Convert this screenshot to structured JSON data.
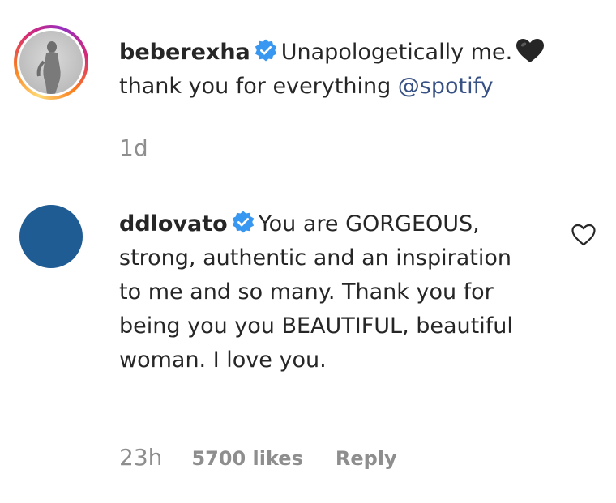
{
  "caption": {
    "username": "beberexha",
    "text_line1": "Unapologetically me.",
    "text_line2_prefix": "thank you for everything ",
    "mention": "@spotify",
    "emoji": "black-heart-emoji",
    "time": "1d"
  },
  "reply": {
    "username": "ddlovato",
    "text": "You are GORGEOUS, strong, authentic and an inspiration to me and so many. Thank you for being you you BEAUTIFUL, beautiful woman. I love you.",
    "time": "23h",
    "likes": "5700 likes",
    "reply_label": "Reply",
    "avatar_color": "#1f5c93"
  },
  "icons": {
    "verified": "verified-badge-icon",
    "like": "heart-outline-icon"
  },
  "colors": {
    "mention": "#385185",
    "verified": "#3897f0",
    "meta": "#8e8e8e"
  }
}
